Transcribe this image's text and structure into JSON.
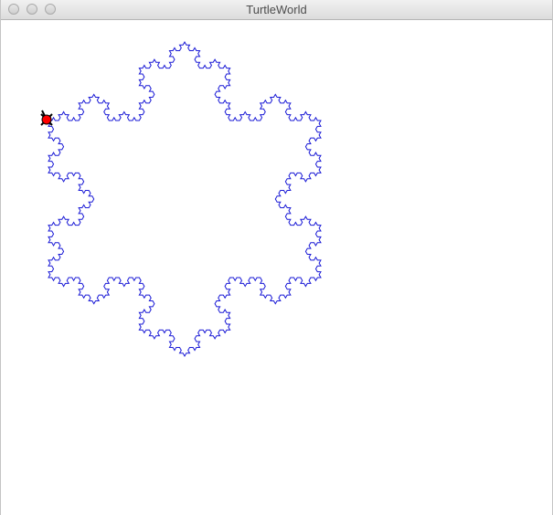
{
  "window": {
    "title": "TurtleWorld"
  },
  "titlebar": {
    "buttons": [
      "close-button",
      "minimize-button",
      "zoom-button"
    ]
  },
  "drawing": {
    "shape": "koch snowflake",
    "line_color": "#1a1ad6",
    "turtle_color": "#ff0000"
  }
}
